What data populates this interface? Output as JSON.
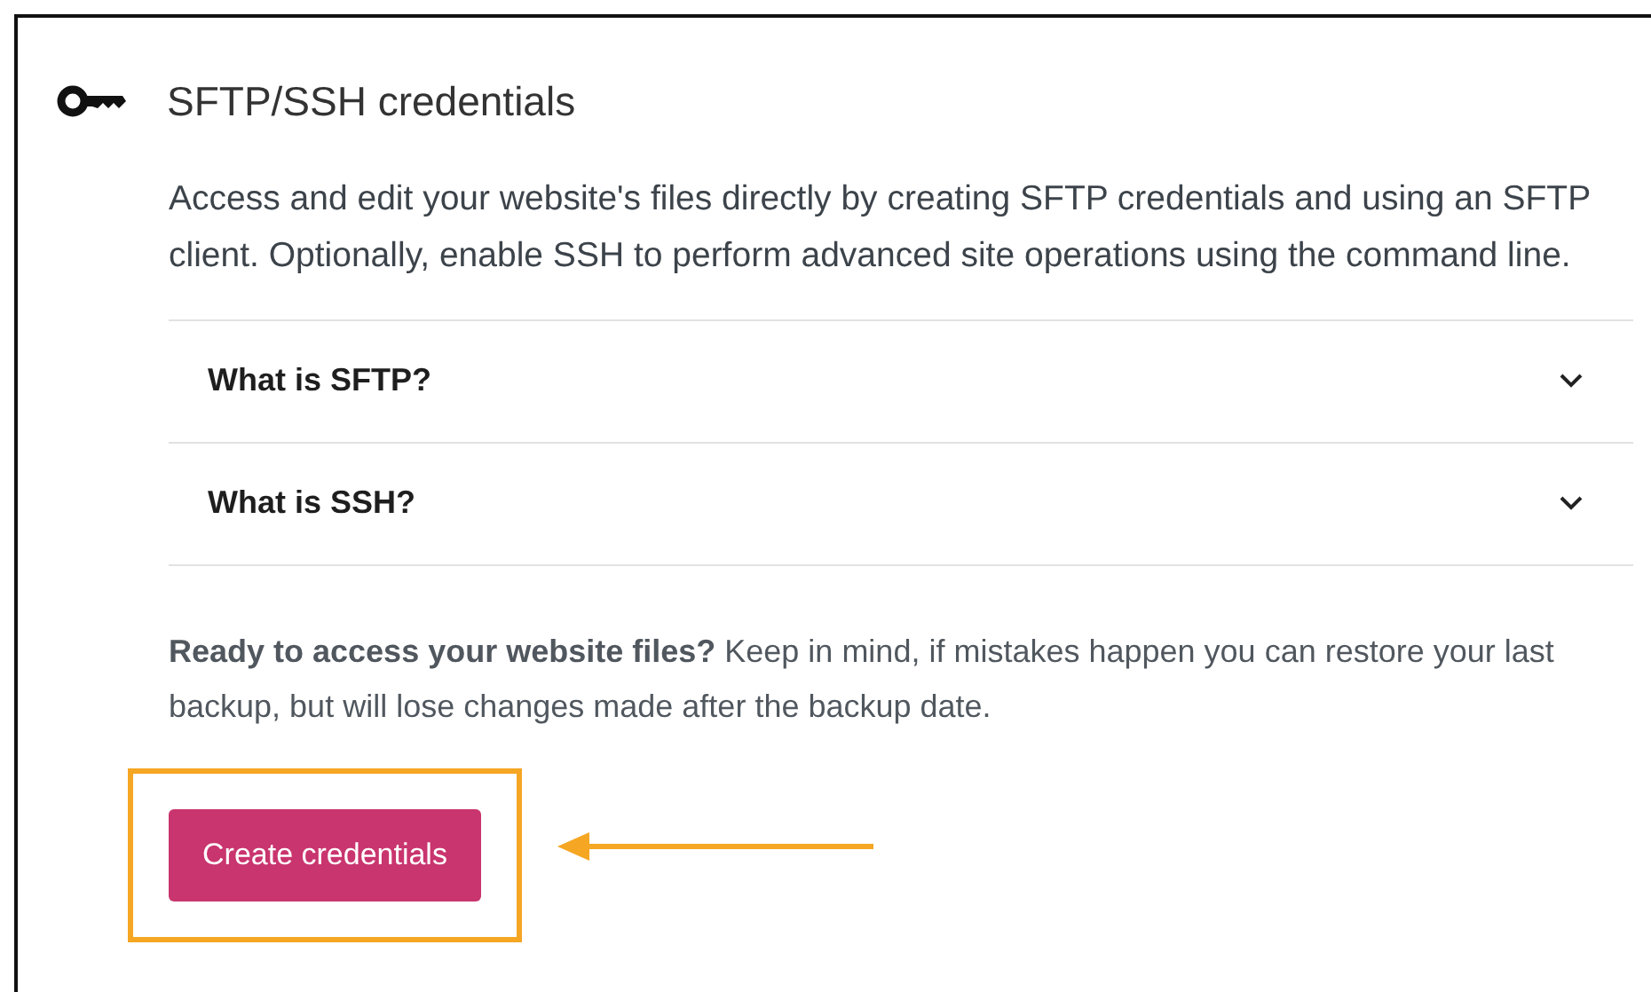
{
  "card": {
    "title": "SFTP/SSH credentials",
    "description": "Access and edit your website's files directly by creating SFTP credentials and using an SFTP client. Optionally, enable SSH to perform advanced site operations using the command line."
  },
  "faq": [
    {
      "question": "What is SFTP?",
      "expanded": false
    },
    {
      "question": "What is SSH?",
      "expanded": false
    }
  ],
  "notice": "**Ready to access your website files?** Keep in mind, if mistakes happen you can restore your last backup, but will lose changes made after the backup date.",
  "button": {
    "label": "Create credentials",
    "highlighted": true
  }
}
